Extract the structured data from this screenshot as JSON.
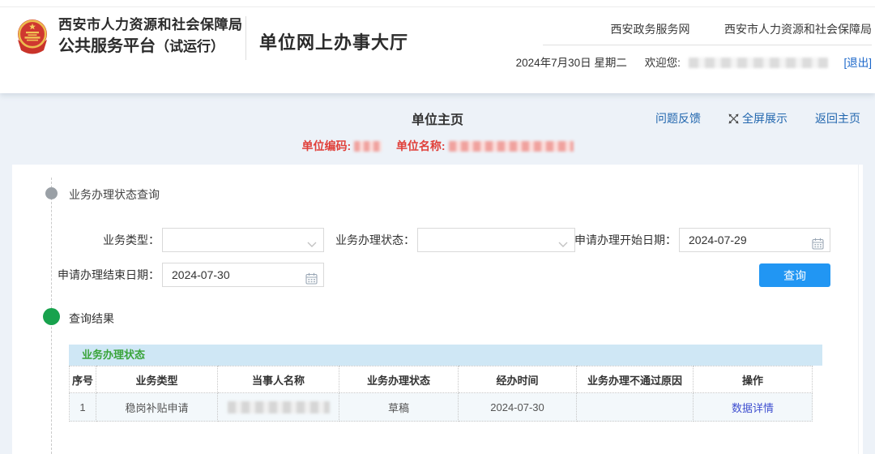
{
  "header": {
    "org_line1": "西安市人力资源和社会保障局",
    "org_line2": "公共服务平台",
    "org_line2_suffix": "（试运行）",
    "hall_title": "单位网上办事大厅",
    "top_links": [
      "西安政务服务网",
      "西安市人力资源和社会保障局"
    ],
    "date_text": "2024年7月30日 星期二",
    "welcome_label": "欢迎您:",
    "logout_label": "[退出]"
  },
  "subheader": {
    "page_title": "单位主页",
    "feedback_link": "问题反馈",
    "fullscreen_link": "全屏展示",
    "back_home_link": "返回主页",
    "unit_code_label": "单位编码:",
    "unit_name_label": "单位名称:"
  },
  "query": {
    "section_title": "业务办理状态查询",
    "business_type_label": "业务类型：",
    "status_label": "业务办理状态：",
    "start_date_label": "申请办理开始日期：",
    "start_date_value": "2024-07-29",
    "end_date_label": "申请办理结束日期：",
    "end_date_value": "2024-07-30",
    "query_button_label": "查询"
  },
  "results": {
    "section_title": "查询结果",
    "table_title": "业务办理状态",
    "columns": [
      "序号",
      "业务类型",
      "当事人名称",
      "业务办理状态",
      "经办时间",
      "业务办理不通过原因",
      "操作"
    ],
    "rows": [
      {
        "seq": "1",
        "business_type": "稳岗补贴申请",
        "status": "草稿",
        "handle_time": "2024-07-30",
        "fail_reason": "",
        "action": "数据详情"
      }
    ]
  },
  "colors": {
    "accent_blue": "#2196f3",
    "link_blue": "#2166ae",
    "logout_blue": "#1a66c9",
    "red": "#e0403a",
    "bullet_green": "#18a24d",
    "table_title_green": "#3aa43a",
    "table_band_bg": "#cfe7f5",
    "detail_link_blue": "#3f4fd0",
    "page_bg": "#edf2f8"
  }
}
